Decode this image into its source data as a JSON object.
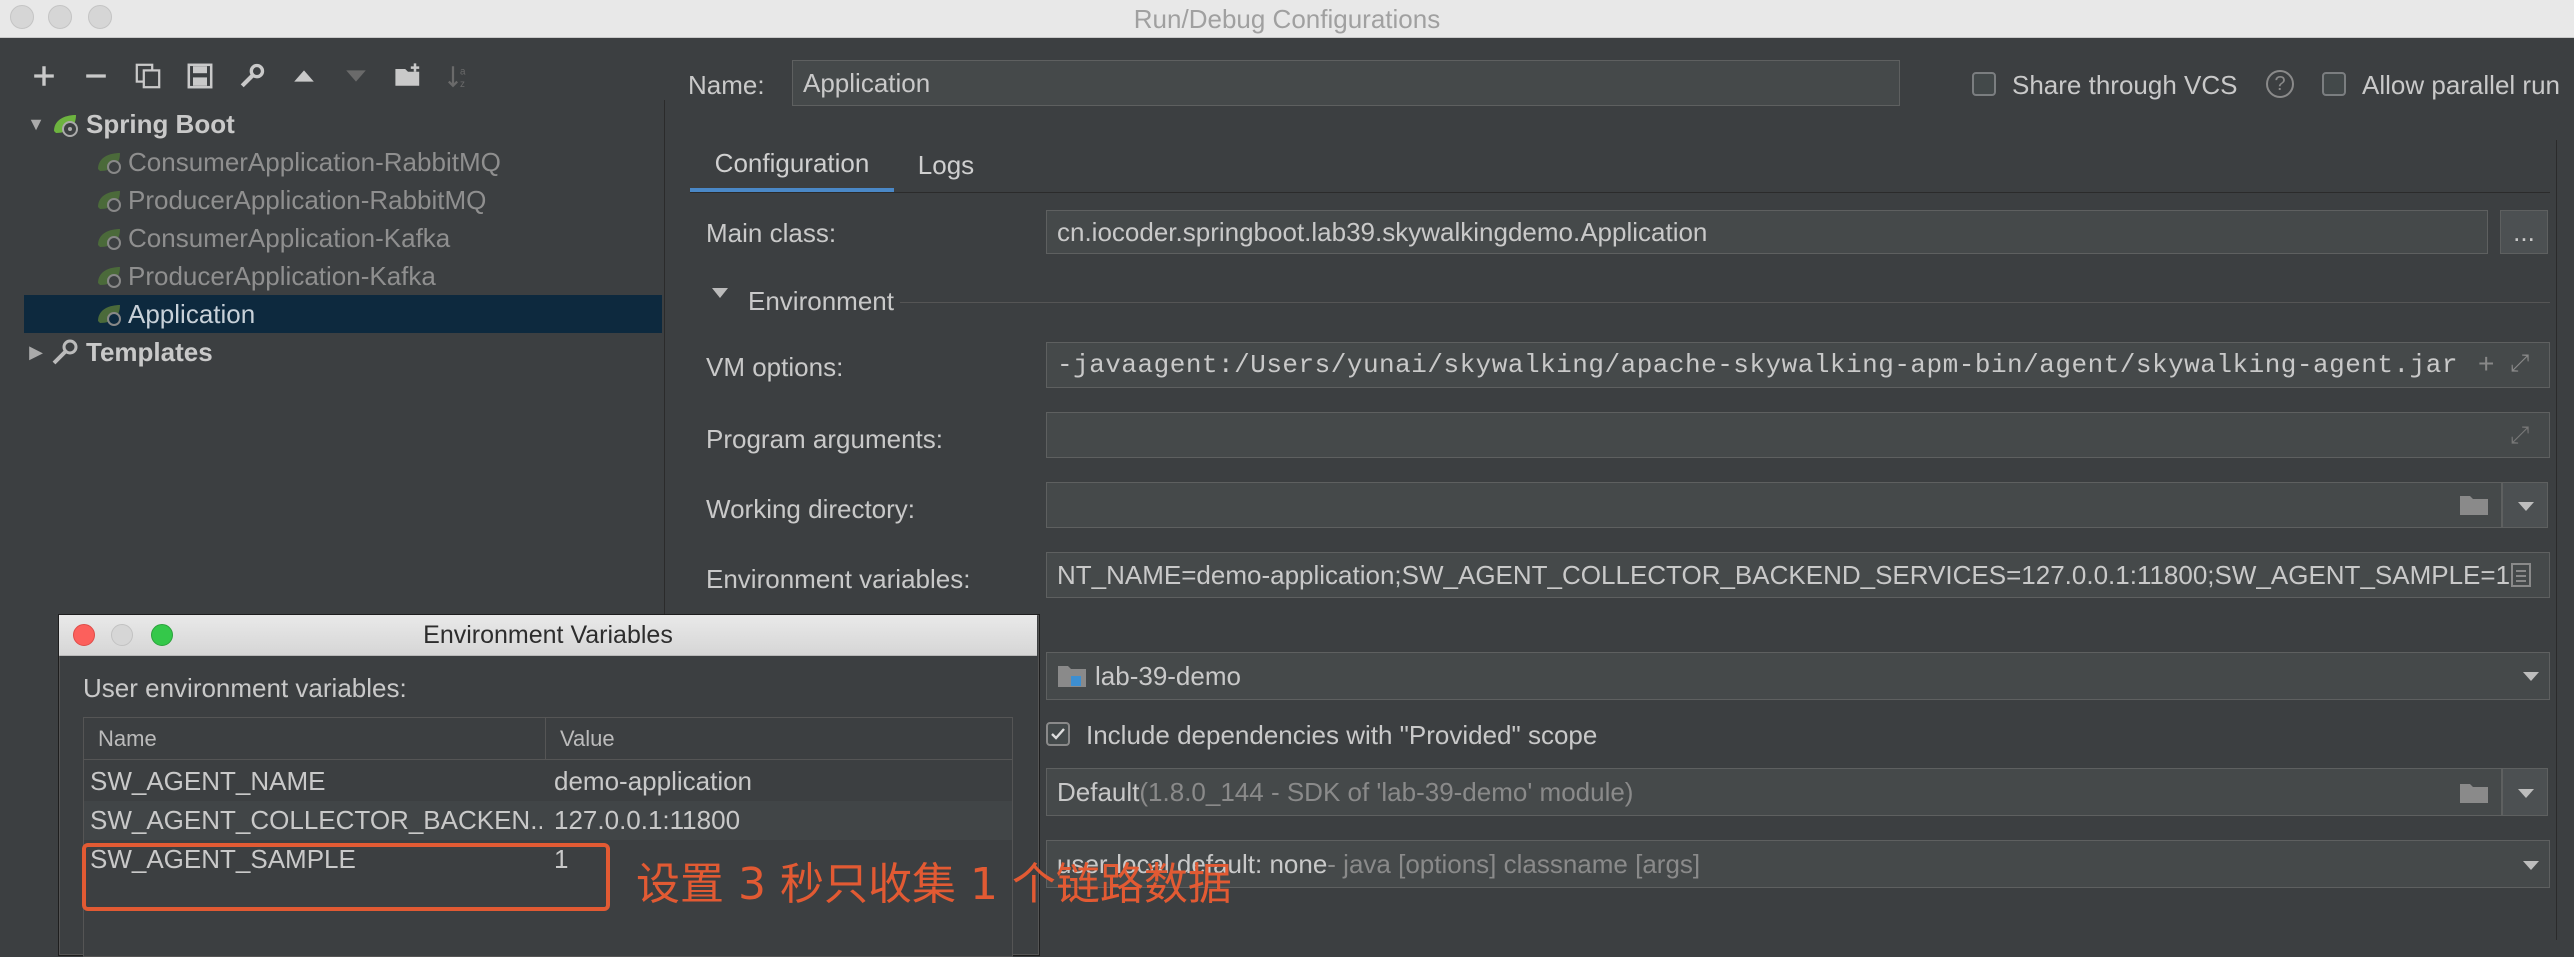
{
  "window": {
    "title": "Run/Debug Configurations"
  },
  "toolbar_icons": [
    "add-icon",
    "remove-icon",
    "copy-icon",
    "save-icon",
    "wrench-icon",
    "move-up-icon",
    "move-down-icon",
    "new-folder-icon",
    "sort-icon"
  ],
  "tree": {
    "root_label": "Spring Boot",
    "items": [
      "ConsumerApplication-RabbitMQ",
      "ProducerApplication-RabbitMQ",
      "ConsumerApplication-Kafka",
      "ProducerApplication-Kafka",
      "Application"
    ],
    "selected": "Application",
    "templates_label": "Templates"
  },
  "header": {
    "name_label": "Name:",
    "name_value": "Application",
    "share_vcs_label": "Share through VCS",
    "allow_parallel_label": "Allow parallel run"
  },
  "tabs": [
    "Configuration",
    "Logs"
  ],
  "config": {
    "main_class_label": "Main class:",
    "main_class_value": "cn.iocoder.springboot.lab39.skywalkingdemo.Application",
    "environment_section": "Environment",
    "vm_options_label": "VM options:",
    "vm_options_value": "-javaagent:/Users/yunai/skywalking/apache-skywalking-apm-bin/agent/skywalking-agent.jar",
    "program_args_label": "Program arguments:",
    "working_dir_label": "Working directory:",
    "env_vars_label": "Environment variables:",
    "env_vars_value": "NT_NAME=demo-application;SW_AGENT_COLLECTOR_BACKEND_SERVICES=127.0.0.1:11800;SW_AGENT_SAMPLE=1",
    "module_value": "lab-39-demo",
    "include_provided_label": "Include dependencies with \"Provided\" scope",
    "jre_value": "Default",
    "jre_detail": " (1.8.0_144 - SDK of 'lab-39-demo' module)",
    "shorten_value": "user-local default: none",
    "shorten_detail": " - java [options] classname [args]",
    "browse_button": "..."
  },
  "dialog": {
    "title": "Environment Variables",
    "subtitle": "User environment variables:",
    "columns": [
      "Name",
      "Value"
    ],
    "rows": [
      {
        "name": "SW_AGENT_NAME",
        "value": "demo-application"
      },
      {
        "name": "SW_AGENT_COLLECTOR_BACKEN...",
        "value": "127.0.0.1:11800"
      },
      {
        "name": "SW_AGENT_SAMPLE",
        "value": "1"
      }
    ]
  },
  "annotation": {
    "text": "设置 3 秒只收集 1 个链路数据",
    "color": "#e25a33"
  },
  "colors": {
    "accent": "#4a88c7",
    "selection": "#0d293e",
    "background": "#3c3f41"
  }
}
